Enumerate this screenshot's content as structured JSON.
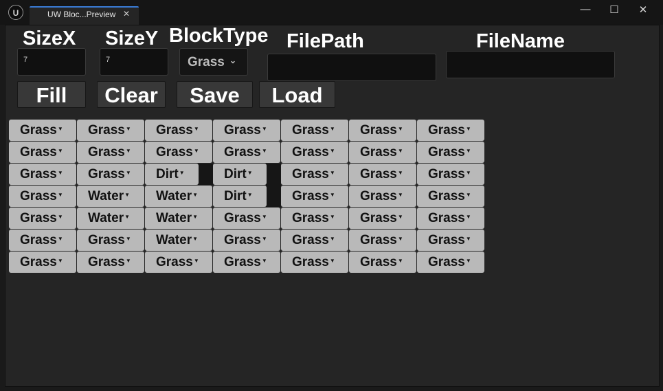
{
  "titlebar": {
    "logo": "U",
    "tab_label": "UW Bloc...Preview",
    "tab_close": "✕",
    "minimize": "—",
    "maximize": "☐",
    "close": "✕"
  },
  "form": {
    "sizex_label": "SizeX",
    "sizex_value": "7",
    "sizey_label": "SizeY",
    "sizey_value": "7",
    "blocktype_label": "BlockType",
    "blocktype_value": "Grass",
    "filepath_label": "FilePath",
    "filepath_value": "",
    "filename_label": "FileName",
    "filename_value": ""
  },
  "buttons": {
    "fill": "Fill",
    "clear": "Clear",
    "save": "Save",
    "load": "Load"
  },
  "grid": [
    [
      "Grass",
      "Grass",
      "Grass",
      "Grass",
      "Grass",
      "Grass",
      "Grass"
    ],
    [
      "Grass",
      "Grass",
      "Grass",
      "Grass",
      "Grass",
      "Grass",
      "Grass"
    ],
    [
      "Grass",
      "Grass",
      "Dirt",
      "Dirt",
      "Grass",
      "Grass",
      "Grass"
    ],
    [
      "Grass",
      "Water",
      "Water",
      "Dirt",
      "Grass",
      "Grass",
      "Grass"
    ],
    [
      "Grass",
      "Water",
      "Water",
      "Grass",
      "Grass",
      "Grass",
      "Grass"
    ],
    [
      "Grass",
      "Grass",
      "Water",
      "Grass",
      "Grass",
      "Grass",
      "Grass"
    ],
    [
      "Grass",
      "Grass",
      "Grass",
      "Grass",
      "Grass",
      "Grass",
      "Grass"
    ]
  ],
  "icons": {
    "dropdown": "chevron-down-icon",
    "cell_dropdown": "caret-down-icon"
  }
}
